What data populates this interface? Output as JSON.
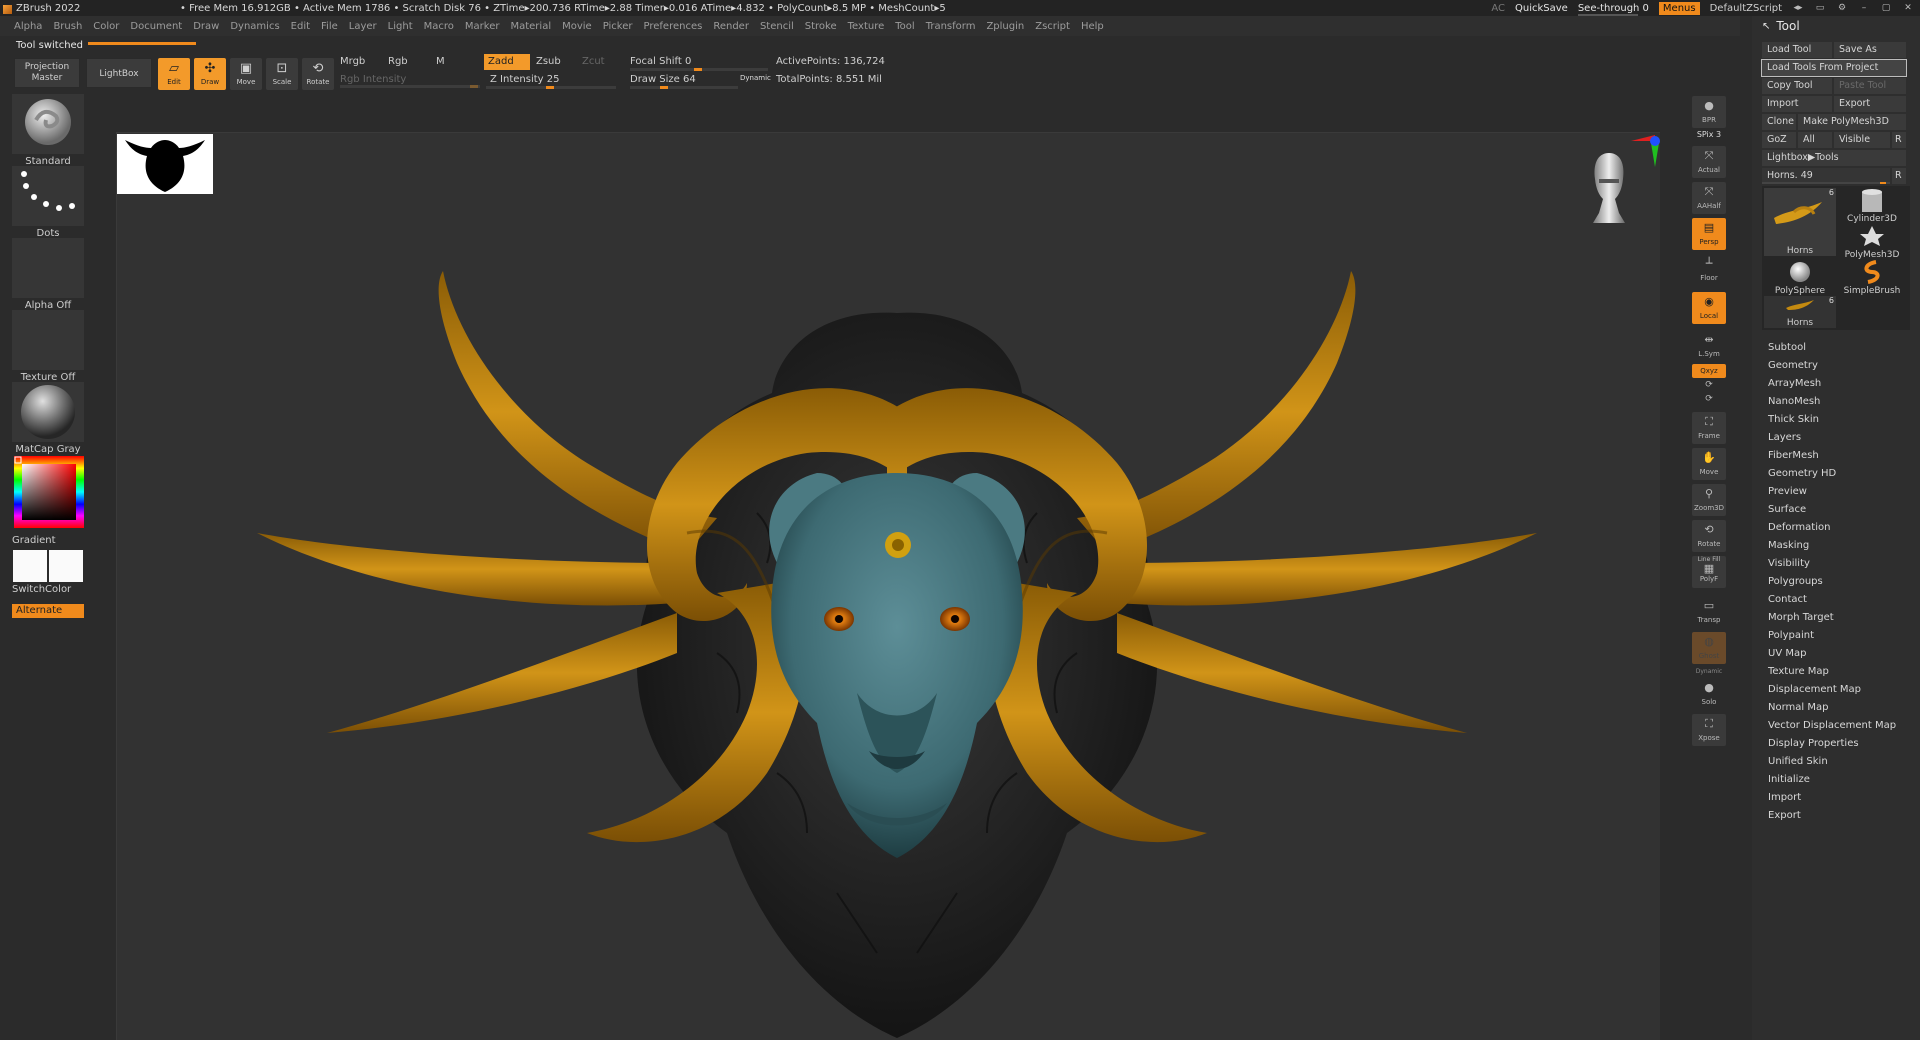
{
  "titlebar": {
    "app_name": "ZBrush 2022",
    "stats": "​• Free Mem 16.912GB • Active Mem 1786 • Scratch Disk 76 • ZTime▸200.736 RTime▸2.88 Timer▸0.016 ATime▸4.832 • PolyCount▸8.5 MP • MeshCount▸5",
    "ac": "AC",
    "quicksave": "QuickSave",
    "see_through": "See-through  0",
    "menus": "Menus",
    "default_zscript": "DefaultZScript"
  },
  "menubar": [
    "Alpha",
    "Brush",
    "Color",
    "Document",
    "Draw",
    "Dynamics",
    "Edit",
    "File",
    "Layer",
    "Light",
    "Macro",
    "Marker",
    "Material",
    "Movie",
    "Picker",
    "Preferences",
    "Render",
    "Stencil",
    "Stroke",
    "Texture",
    "Tool",
    "Transform",
    "Zplugin",
    "Zscript",
    "Help"
  ],
  "status": "Tool switched",
  "shelf": {
    "projection_master": "Projection Master",
    "lightbox": "LightBox",
    "edit": "Edit",
    "draw": "Draw",
    "move": "Move",
    "scale": "Scale",
    "rotate": "Rotate",
    "mrgb": "Mrgb",
    "rgb": "Rgb",
    "m": "M",
    "rgb_intensity": "Rgb Intensity",
    "zadd": "Zadd",
    "zsub": "Zsub",
    "zcut": "Zcut",
    "z_intensity": "Z Intensity 25",
    "focal_shift": "Focal Shift 0",
    "draw_size": "Draw Size 64",
    "dynamic": "Dynamic",
    "active_points": "ActivePoints: 136,724",
    "total_points": "TotalPoints: 8.551 Mil"
  },
  "leftpanel": {
    "standard": "Standard",
    "dots": "Dots",
    "alpha_off": "Alpha Off",
    "texture_off": "Texture Off",
    "matcap": "MatCap Gray",
    "gradient": "Gradient",
    "switchcolor": "SwitchColor",
    "alternate": "Alternate"
  },
  "rightshelf": {
    "bpr": "BPR",
    "spix": "SPix 3",
    "actual": "Actual",
    "aahalf": "AAHalf",
    "persp": "Persp",
    "floor": "Floor",
    "local": "Local",
    "lsym": "L.Sym",
    "xyz": "Qxyz",
    "frame": "Frame",
    "move": "Move",
    "zoom3d": "Zoom3D",
    "rotate": "Rotate",
    "linefill": "Line Fill",
    "polyf": "PolyF",
    "transp": "Transp",
    "ghost": "Ghost",
    "dynamic": "Dynamic",
    "solo": "Solo",
    "xpose": "Xpose"
  },
  "tool": {
    "title": "Tool",
    "load_tool": "Load Tool",
    "save_as": "Save As",
    "load_from_project": "Load Tools From Project",
    "copy_tool": "Copy Tool",
    "paste_tool": "Paste Tool",
    "import": "Import",
    "export": "Export",
    "clone": "Clone",
    "make_polymesh": "Make PolyMesh3D",
    "goz": "GoZ",
    "all": "All",
    "visible": "Visible",
    "r": "R",
    "lightbox_tools": "Lightbox▶Tools",
    "current": "Horns. 49",
    "thumbs": [
      {
        "label": "Horns",
        "count": "6"
      },
      {
        "label": "Cylinder3D",
        "count": ""
      },
      {
        "label": "",
        "count": ""
      },
      {
        "label": "PolyMesh3D",
        "count": ""
      },
      {
        "label": "PolySphere",
        "count": ""
      },
      {
        "label": "SimpleBrush",
        "count": ""
      },
      {
        "label": "Horns",
        "count": "6"
      }
    ],
    "sections": [
      "Subtool",
      "Geometry",
      "ArrayMesh",
      "NanoMesh",
      "Thick Skin",
      "Layers",
      "FiberMesh",
      "Geometry HD",
      "Preview",
      "Surface",
      "Deformation",
      "Masking",
      "Visibility",
      "Polygroups",
      "Contact",
      "Morph Target",
      "Polypaint",
      "UV Map",
      "Texture Map",
      "Displacement Map",
      "Normal Map",
      "Vector Displacement Map",
      "Display Properties",
      "Unified Skin",
      "Initialize",
      "Import",
      "Export"
    ]
  },
  "colors": {
    "accent": "#f08a1c",
    "skin": "#3f6f78",
    "horn": "#c98a12",
    "mane": "#1d1d1d"
  }
}
